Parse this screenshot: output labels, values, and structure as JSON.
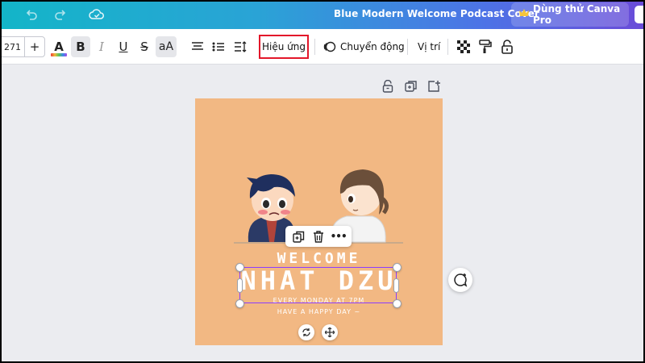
{
  "topbar": {
    "title": "Blue Modern Welcome Podcast Cover",
    "pro_button": "Dùng thử Canva Pro",
    "icons": [
      "undo-icon",
      "redo-icon",
      "cloud-save-icon",
      "crown-icon"
    ]
  },
  "toolbar": {
    "font_size": "271",
    "plus_label": "+",
    "color_a": "A",
    "bold": "B",
    "italic": "I",
    "underline": "U",
    "strike": "S",
    "case": "aA",
    "effects": "Hiệu ứng",
    "animate": "Chuyển động",
    "position": "Vị trí",
    "icons": [
      "align-center-icon",
      "list-icon",
      "line-spacing-icon",
      "animate-icon",
      "transparency-icon",
      "paint-roller-icon",
      "lock-icon"
    ]
  },
  "canvas": {
    "page_color": "#f2b883",
    "top_icons": [
      "lock-icon",
      "duplicate-icon",
      "add-page-icon"
    ],
    "welcome": "WELCOME",
    "name": "NHAT DZU",
    "every": "EVERY MONDAY AT 7PM",
    "happy": "HAVE A HAPPY DAY ~"
  },
  "context_menu": {
    "icons": [
      "copy-icon",
      "trash-icon",
      "more-icon"
    ],
    "more": "•••"
  },
  "colors": {
    "selection": "#8b3dff",
    "highlight": "#e3172a"
  }
}
